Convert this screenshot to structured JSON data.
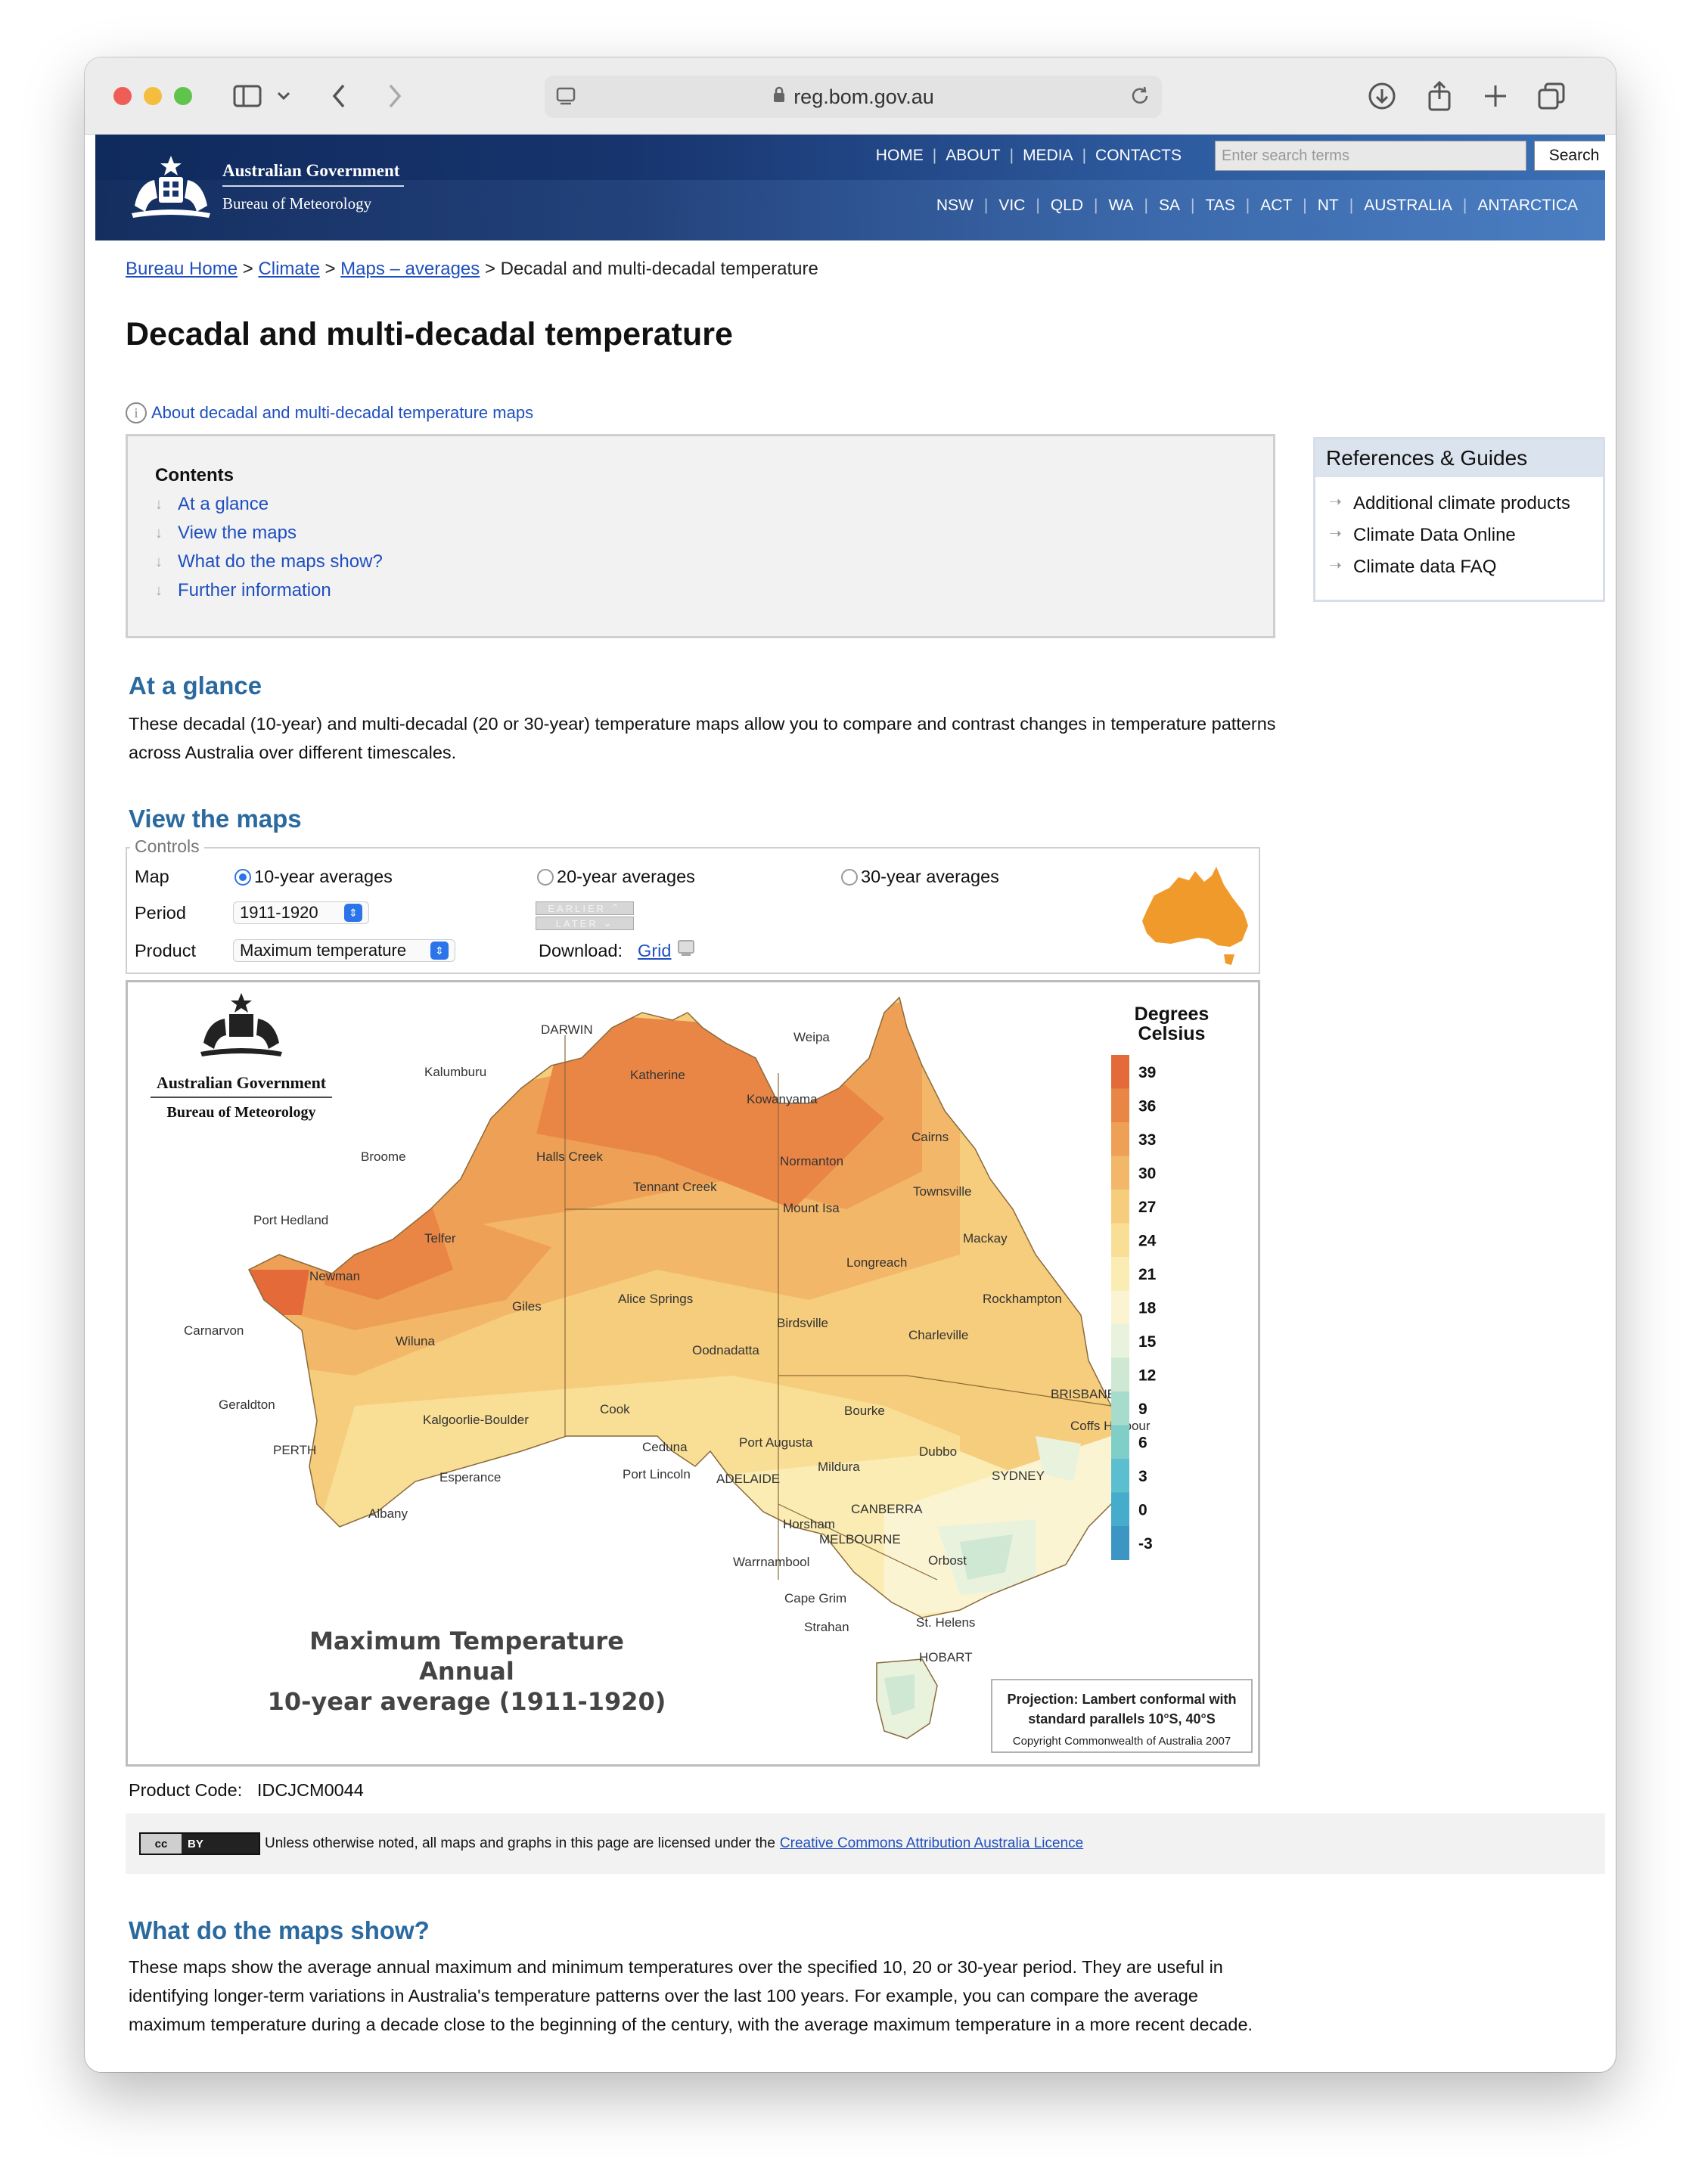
{
  "browser": {
    "url": "reg.bom.gov.au"
  },
  "header": {
    "gov_name": "Australian Government",
    "agency_name": "Bureau of Meteorology",
    "top_nav": [
      "HOME",
      "ABOUT",
      "MEDIA",
      "CONTACTS"
    ],
    "search_placeholder": "Enter search terms",
    "search_button": "Search",
    "state_nav": [
      "NSW",
      "VIC",
      "QLD",
      "WA",
      "SA",
      "TAS",
      "ACT",
      "NT",
      "AUSTRALIA",
      "ANTARCTICA"
    ]
  },
  "breadcrumb": {
    "items": [
      "Bureau Home",
      "Climate",
      "Maps – averages"
    ],
    "separator": ">",
    "current": "Decadal and multi-decadal temperature"
  },
  "page_title": "Decadal and multi-decadal temperature",
  "about_link": "About decadal and multi-decadal temperature maps",
  "contents": {
    "title": "Contents",
    "items": [
      "At a glance",
      "View the maps",
      "What do the maps show?",
      "Further information"
    ]
  },
  "references": {
    "title": "References & Guides",
    "items": [
      "Additional climate products",
      "Climate Data Online",
      "Climate data FAQ"
    ]
  },
  "at_a_glance": {
    "heading": "At a glance",
    "text": "These decadal (10-year) and multi-decadal (20 or 30-year) temperature maps allow you to compare and contrast changes in temperature patterns across Australia over different timescales."
  },
  "view_maps": {
    "heading": "View the maps",
    "controls_legend": "Controls",
    "map_label": "Map",
    "map_options": [
      "10-year averages",
      "20-year averages",
      "30-year averages"
    ],
    "map_selected": "10-year averages",
    "period_label": "Period",
    "period_value": "1911-1920",
    "earlier_label": "EARLIER",
    "later_label": "LATER",
    "product_label": "Product",
    "product_value": "Maximum temperature",
    "download_label": "Download:",
    "download_link": "Grid"
  },
  "map": {
    "gov_name": "Australian Government",
    "agency_name": "Bureau of Meteorology",
    "title_line1": "Maximum Temperature",
    "title_line2": "Annual",
    "title_line3": "10-year average (1911-1920)",
    "legend_title_1": "Degrees",
    "legend_title_2": "Celsius",
    "legend_values": [
      "39",
      "36",
      "33",
      "30",
      "27",
      "24",
      "21",
      "18",
      "15",
      "12",
      "9",
      "6",
      "3",
      "0",
      "-3"
    ],
    "legend_colors": [
      "#e46a3a",
      "#ea8645",
      "#eea056",
      "#f2b768",
      "#f6cd7c",
      "#f9de95",
      "#fbecb3",
      "#fbf4d3",
      "#e9f2dc",
      "#cfe8d3",
      "#a7dccc",
      "#7fcfc8",
      "#5cbfd0",
      "#45accb",
      "#3d95c4"
    ],
    "places": [
      "DARWIN",
      "Weipa",
      "Kalumburu",
      "Katherine",
      "Kowanyama",
      "Cairns",
      "Broome",
      "Halls Creek",
      "Normanton",
      "Tennant Creek",
      "Townsville",
      "Mount Isa",
      "Port Hedland",
      "Telfer",
      "Mackay",
      "Newman",
      "Longreach",
      "Giles",
      "Alice Springs",
      "Rockhampton",
      "Carnarvon",
      "Birdsville",
      "Charleville",
      "Wiluna",
      "Oodnadatta",
      "BRISBANE",
      "Geraldton",
      "Cook",
      "Bourke",
      "Kalgoorlie-Boulder",
      "Coffs Harbour",
      "PERTH",
      "Ceduna",
      "Port Augusta",
      "Dubbo",
      "Mildura",
      "Esperance",
      "Port Lincoln",
      "ADELAIDE",
      "SYDNEY",
      "Albany",
      "CANBERRA",
      "Horsham",
      "MELBOURNE",
      "Warrnambool",
      "Orbost",
      "Cape Grim",
      "St. Helens",
      "Strahan",
      "HOBART"
    ],
    "projection_1": "Projection: Lambert conformal with",
    "projection_2": "standard parallels 10°S, 40°S",
    "copyright": "Copyright Commonwealth of Australia 2007"
  },
  "product_code_label": "Product Code:",
  "product_code": "IDCJCM0044",
  "licence": {
    "badge_left": "cc",
    "badge_right": "BY",
    "text": "Unless otherwise noted, all maps and graphs in this page are licensed under the",
    "link": "Creative Commons Attribution Australia Licence"
  },
  "what_maps_show": {
    "heading": "What do the maps show?",
    "text": "These maps show the average annual maximum and minimum temperatures over the specified 10, 20 or 30-year period. They are useful in identifying longer-term variations in Australia's temperature patterns over the last 100 years. For example, you can compare the average maximum temperature during a decade close to the beginning of the century, with the average maximum temperature in a more recent decade."
  }
}
